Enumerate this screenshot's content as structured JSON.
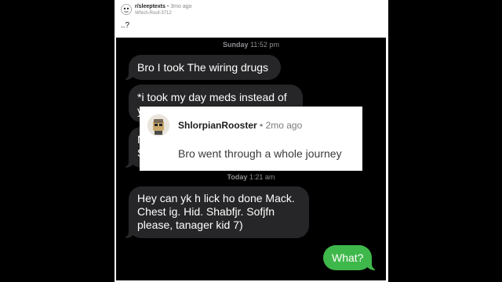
{
  "post": {
    "subreddit": "r/sleeptexts",
    "age": "3mo ago",
    "username": "Which-Roof-3712",
    "title": "..?"
  },
  "chat": {
    "timestamp1_day": "Sunday",
    "timestamp1_time": "11:52 pm",
    "timestamp2_day": "Today",
    "timestamp2_time": "1:21 am",
    "messages": [
      {
        "text": "Bro I took The wiring drugs",
        "sender": "them"
      },
      {
        "text": "*i took my day meds instead of y",
        "sender": "them"
      },
      {
        "text": "N S",
        "sender": "them"
      },
      {
        "text": "Hey can yk h lick ho done Mack. Chest ig. Hid. Shabfjr. Sofjfn please,  tanager kid 7)",
        "sender": "them"
      },
      {
        "text": "What?",
        "sender": "me"
      }
    ]
  },
  "comment": {
    "username": "ShlorpianRooster",
    "age": "2mo ago",
    "body": "Bro went through a whole journey"
  },
  "colors": {
    "received_bubble": "#262628",
    "sent_bubble": "#3fb84b",
    "chat_background": "#000000"
  }
}
